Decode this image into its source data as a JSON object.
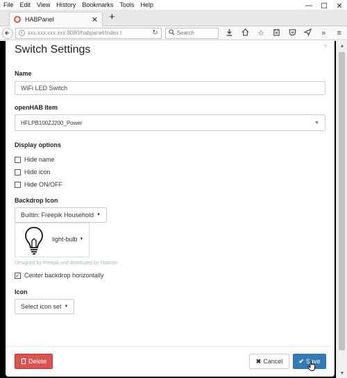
{
  "menubar": {
    "items": [
      "File",
      "Edit",
      "View",
      "History",
      "Bookmarks",
      "Tools",
      "Help"
    ]
  },
  "window_controls": {
    "minimize": "—",
    "maximize": "☐",
    "close": "✕"
  },
  "tab": {
    "title": "HABPanel",
    "close": "✕",
    "new_tab": "+"
  },
  "address": {
    "url": "xxx.xxx.xxx.xxx:8080/habpanel/index.t",
    "search_placeholder": "Search"
  },
  "modal": {
    "title": "Switch Settings",
    "close": "×",
    "name_label": "Name",
    "name_value": "WiFi LED Switch",
    "item_label": "openHAB Item",
    "item_value": "HFLPB100ZJ200_Power",
    "display_label": "Display options",
    "options": [
      {
        "label": "Hide name",
        "checked": false
      },
      {
        "label": "Hide icon",
        "checked": false
      },
      {
        "label": "Hide ON/OFF",
        "checked": false
      }
    ],
    "backdrop_label": "Backdrop Icon",
    "backdrop_set": "Builtin: Freepik Household",
    "backdrop_icon": "light-bulb",
    "attribution": "Designed by Freepik and distributed by Flaticon",
    "center_label": "Center backdrop horizontally",
    "center_checked": true,
    "icon_label": "Icon",
    "icon_set": "Select icon set"
  },
  "footer": {
    "delete_label": "Delete",
    "cancel_label": "Cancel",
    "save_label": "Save"
  },
  "colors": {
    "delete": "#d9534f",
    "save": "#337ab7",
    "attribution": "#a5b6c4"
  }
}
